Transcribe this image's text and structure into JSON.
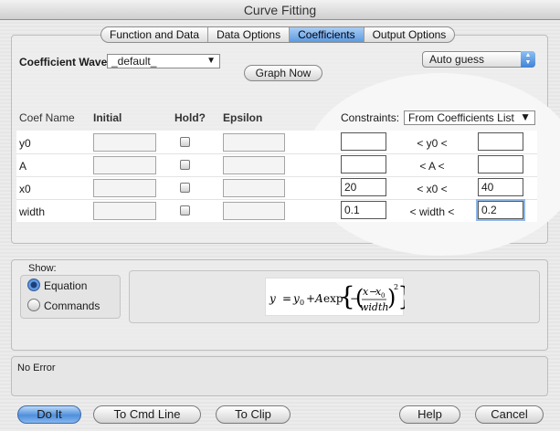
{
  "window": {
    "title": "Curve Fitting"
  },
  "tabs": [
    {
      "label": "Function and Data",
      "active": false
    },
    {
      "label": "Data Options",
      "active": false
    },
    {
      "label": "Coefficients",
      "active": true
    },
    {
      "label": "Output Options",
      "active": false
    }
  ],
  "coef_wave": {
    "label": "Coefficient Wave:",
    "value": "_default_"
  },
  "graph_now_label": "Graph Now",
  "auto_guess": {
    "value": "Auto guess"
  },
  "table_headers": {
    "name": "Coef Name",
    "initial": "Initial",
    "hold": "Hold?",
    "epsilon": "Epsilon"
  },
  "constraints": {
    "label": "Constraints:",
    "mode": "From Coefficients List"
  },
  "coefficients": [
    {
      "name": "y0",
      "initial": "",
      "hold": false,
      "epsilon": "",
      "low": "",
      "mid": "< y0 <",
      "high": ""
    },
    {
      "name": "A",
      "initial": "",
      "hold": false,
      "epsilon": "",
      "low": "",
      "mid": "< A <",
      "high": ""
    },
    {
      "name": "x0",
      "initial": "",
      "hold": false,
      "epsilon": "",
      "low": "20",
      "mid": "< x0 <",
      "high": "40"
    },
    {
      "name": "width",
      "initial": "",
      "hold": false,
      "epsilon": "",
      "low": "0.1",
      "mid": "< width <",
      "high": "0.2"
    }
  ],
  "show": {
    "label": "Show:",
    "options": [
      {
        "label": "Equation",
        "selected": true
      },
      {
        "label": "Commands",
        "selected": false
      }
    ]
  },
  "equation": {
    "lhs": "y",
    "eq": "=",
    "y": "y",
    "sub0": "0",
    "plus": "+",
    "A": "A",
    "exp": "exp",
    "minus": "−",
    "x": "x",
    "dash": "−",
    "x0": "x",
    "x0sub": "0",
    "width": "width",
    "power": "2"
  },
  "status": {
    "message": "No Error"
  },
  "buttons": {
    "do_it": "Do It",
    "to_cmd_line": "To Cmd Line",
    "to_clip": "To Clip",
    "help": "Help",
    "cancel": "Cancel"
  }
}
